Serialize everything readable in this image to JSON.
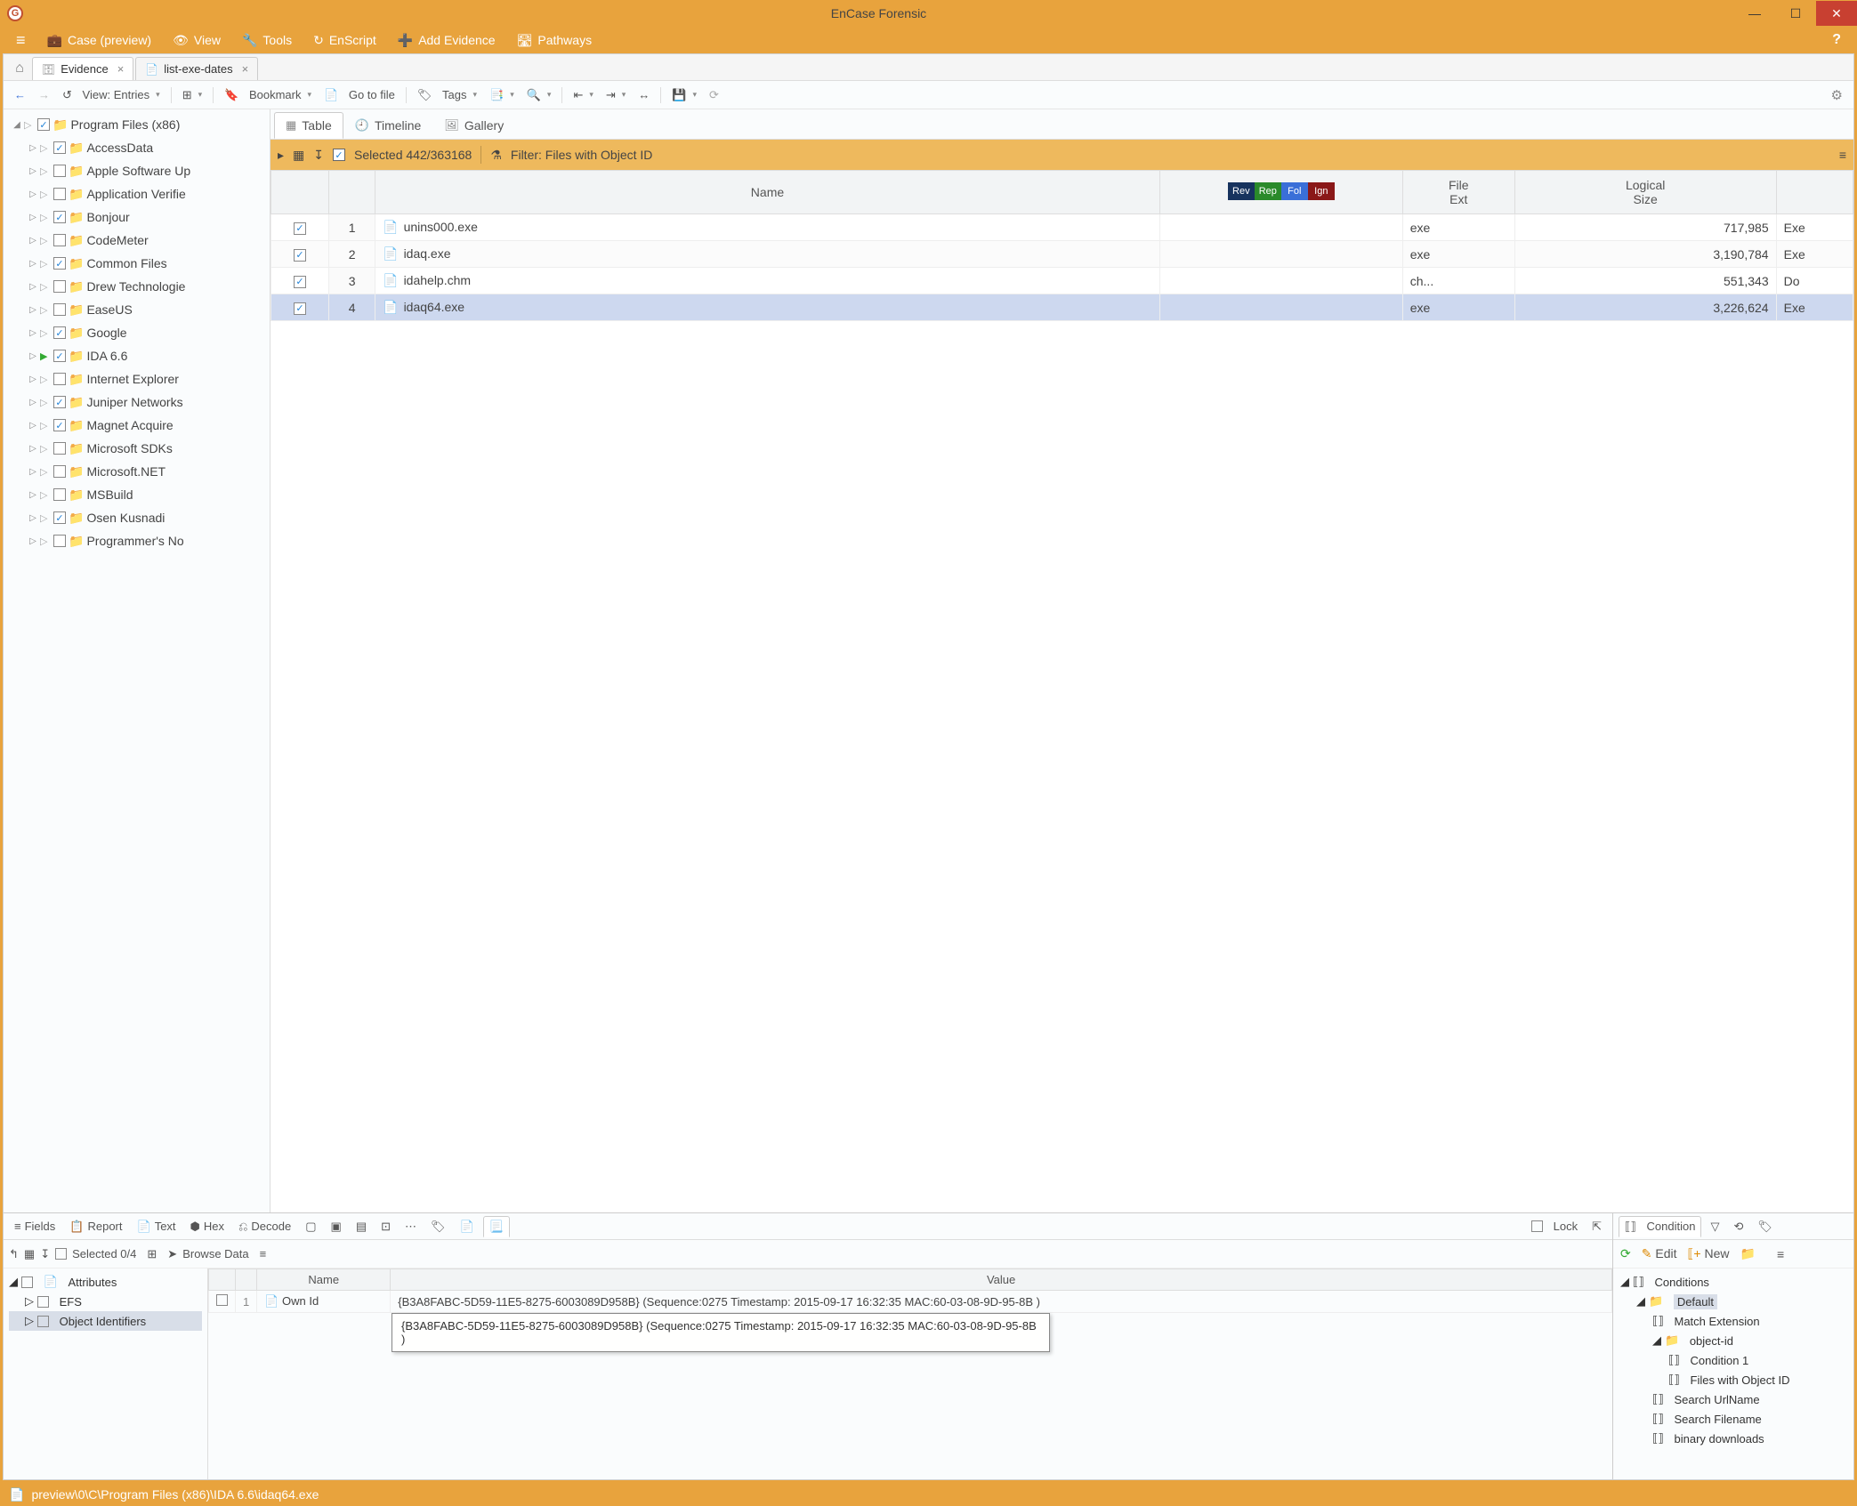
{
  "window": {
    "title": "EnCase Forensic",
    "app_glyph": "G"
  },
  "menu": {
    "case": "Case (preview)",
    "view": "View",
    "tools": "Tools",
    "enscript": "EnScript",
    "add_evidence": "Add Evidence",
    "pathways": "Pathways"
  },
  "tabs": [
    {
      "label": "Evidence",
      "active": true
    },
    {
      "label": "list-exe-dates",
      "active": false
    }
  ],
  "toolbar": {
    "view_entries": "View: Entries",
    "bookmark": "Bookmark",
    "goto_file": "Go to file",
    "tags": "Tags"
  },
  "tree": {
    "root": "Program Files (x86)",
    "items": [
      {
        "label": "AccessData",
        "checked": true
      },
      {
        "label": "Apple Software Up",
        "checked": false
      },
      {
        "label": "Application Verifie",
        "checked": false
      },
      {
        "label": "Bonjour",
        "checked": true
      },
      {
        "label": "CodeMeter",
        "checked": false
      },
      {
        "label": "Common Files",
        "checked": true
      },
      {
        "label": "Drew Technologie",
        "checked": false
      },
      {
        "label": "EaseUS",
        "checked": false
      },
      {
        "label": "Google",
        "checked": true
      },
      {
        "label": "IDA 6.6",
        "checked": true,
        "current": true
      },
      {
        "label": "Internet Explorer",
        "checked": false
      },
      {
        "label": "Juniper Networks",
        "checked": true
      },
      {
        "label": "Magnet Acquire",
        "checked": true
      },
      {
        "label": "Microsoft SDKs",
        "checked": false
      },
      {
        "label": "Microsoft.NET",
        "checked": false
      },
      {
        "label": "MSBuild",
        "checked": false
      },
      {
        "label": "Osen Kusnadi",
        "checked": true
      },
      {
        "label": "Programmer's No",
        "checked": false
      }
    ]
  },
  "view_tabs": {
    "table": "Table",
    "timeline": "Timeline",
    "gallery": "Gallery"
  },
  "filter_bar": {
    "selected": "Selected 442/363168",
    "filter": "Filter: Files with Object ID"
  },
  "columns": {
    "name": "Name",
    "tag_rev": "Rev",
    "tag_rep": "Rep",
    "tag_fol": "Fol",
    "tag_ign": "Ign",
    "file_ext": "File\nExt",
    "logical_size": "Logical\nSize",
    "last": "Exe"
  },
  "rows": [
    {
      "idx": "1",
      "name": "unins000.exe",
      "ext": "exe",
      "size": "717,985",
      "last": "Exe",
      "checked": true
    },
    {
      "idx": "2",
      "name": "idaq.exe",
      "ext": "exe",
      "size": "3,190,784",
      "last": "Exe",
      "checked": true
    },
    {
      "idx": "3",
      "name": "idahelp.chm",
      "ext": "ch...",
      "size": "551,343",
      "last": "Do",
      "checked": true
    },
    {
      "idx": "4",
      "name": "idaq64.exe",
      "ext": "exe",
      "size": "3,226,624",
      "last": "Exe",
      "checked": true,
      "selected": true
    }
  ],
  "bottom_tabs": {
    "fields": "Fields",
    "report": "Report",
    "text": "Text",
    "hex": "Hex",
    "decode": "Decode",
    "lock": "Lock"
  },
  "bottom_toolbar": {
    "selected": "Selected 0/4",
    "browse": "Browse Data"
  },
  "attr_tree": {
    "root": "Attributes",
    "efs": "EFS",
    "obj_id": "Object Identifiers"
  },
  "attr_table": {
    "col_name": "Name",
    "col_value": "Value",
    "row1_name": "Own Id",
    "row1_value": "{B3A8FABC-5D59-11E5-8275-6003089D958B} (Sequence:0275 Timestamp: 2015-09-17 16:32:35 MAC:60-03-08-9D-95-8B )"
  },
  "condition": {
    "title": "Condition",
    "edit": "Edit",
    "new": "New",
    "root": "Conditions",
    "default": "Default",
    "match_ext": "Match Extension",
    "object_id": "object-id",
    "cond1": "Condition 1",
    "files_obj": "Files with Object ID",
    "search_url": "Search UrlName",
    "search_file": "Search Filename",
    "binary": "binary downloads"
  },
  "status": {
    "path": "preview\\0\\C\\Program Files (x86)\\IDA 6.6\\idaq64.exe"
  }
}
